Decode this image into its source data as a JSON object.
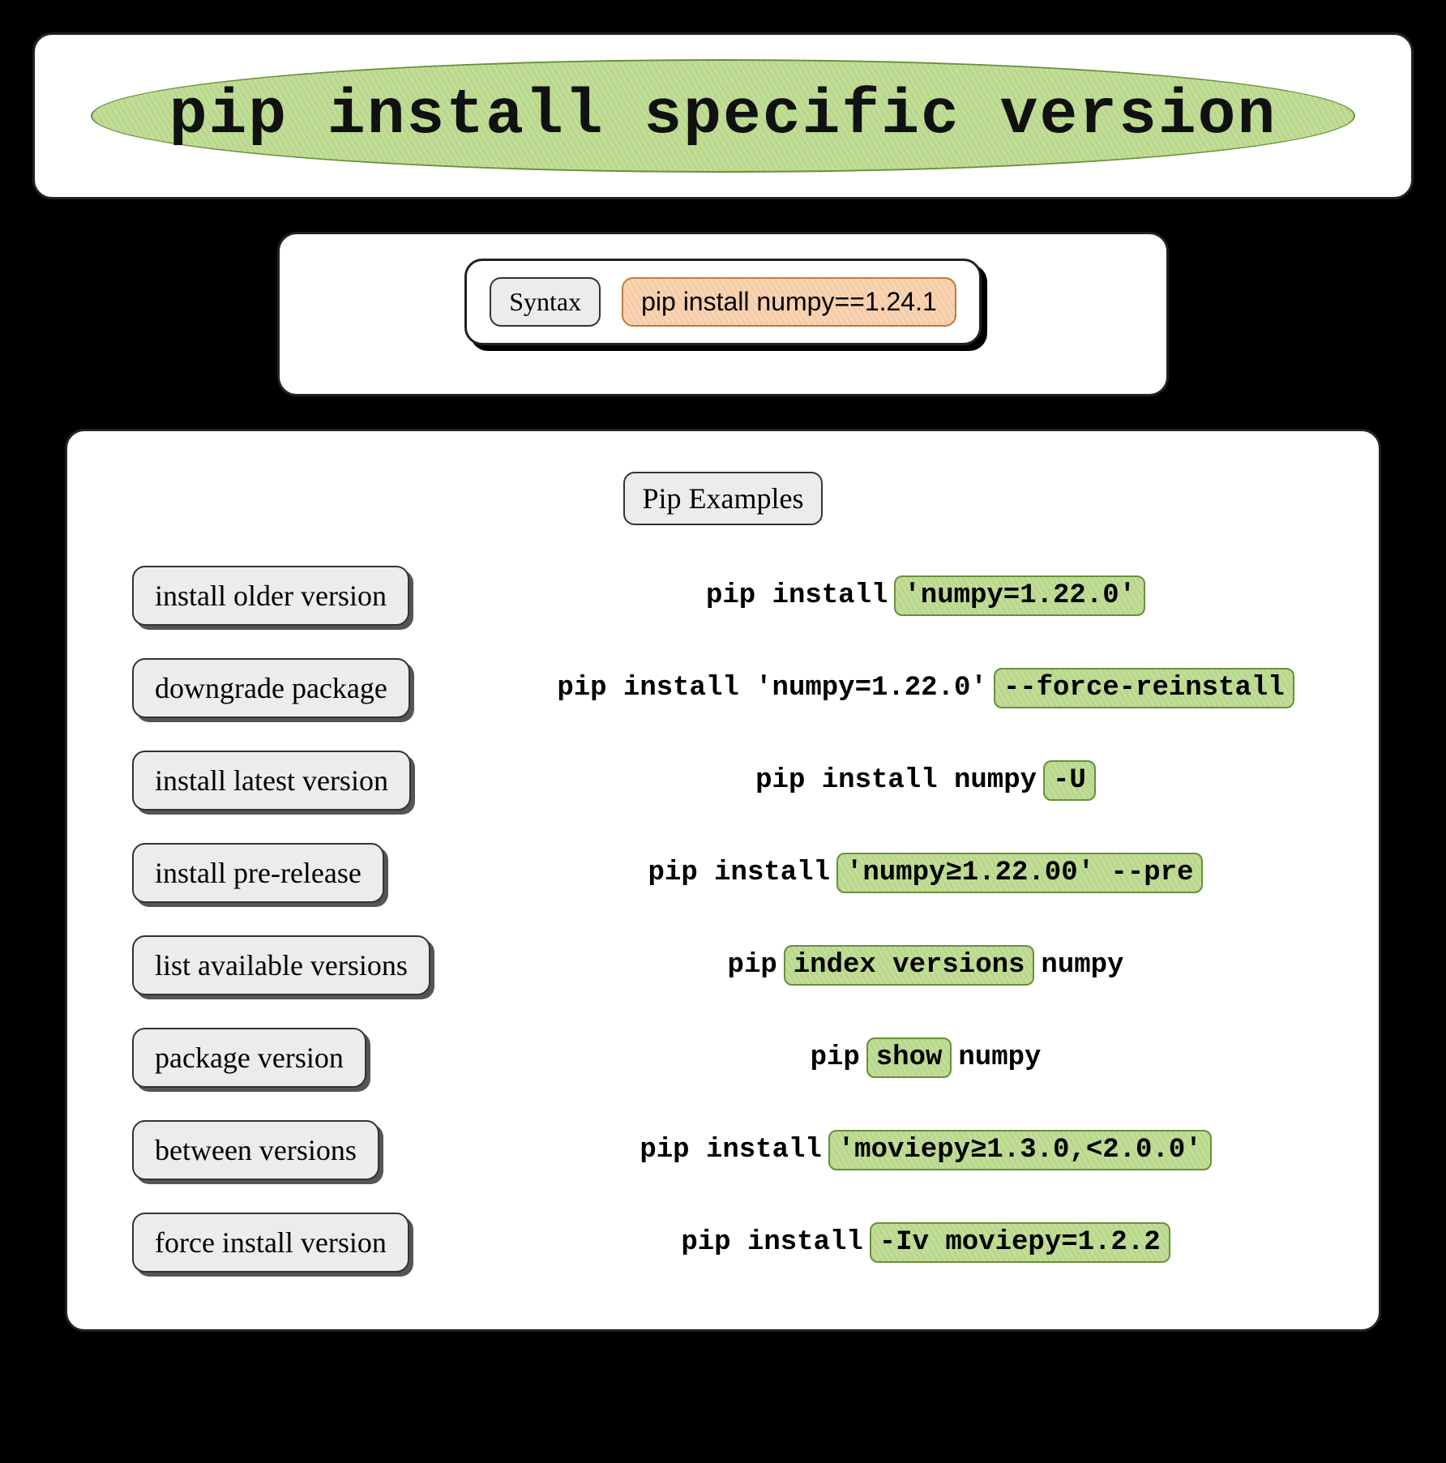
{
  "header": {
    "title": "pip install specific version"
  },
  "syntax": {
    "label": "Syntax",
    "command": "pip install numpy==1.24.1"
  },
  "section_title": "Pip Examples",
  "examples": [
    {
      "label": "install older version",
      "parts": [
        {
          "text": "pip install ",
          "hl": false
        },
        {
          "text": "'numpy=1.22.0'",
          "hl": true
        }
      ]
    },
    {
      "label": "downgrade package",
      "parts": [
        {
          "text": "pip install 'numpy=1.22.0'",
          "hl": false
        },
        {
          "text": "--force-reinstall",
          "hl": true
        }
      ]
    },
    {
      "label": "install latest version",
      "parts": [
        {
          "text": "pip install numpy ",
          "hl": false
        },
        {
          "text": "-U",
          "hl": true
        }
      ]
    },
    {
      "label": "install pre-release",
      "parts": [
        {
          "text": "pip install ",
          "hl": false
        },
        {
          "text": "'numpy≥1.22.00' --pre",
          "hl": true
        }
      ]
    },
    {
      "label": "list available versions",
      "parts": [
        {
          "text": "pip ",
          "hl": false
        },
        {
          "text": "index versions",
          "hl": true
        },
        {
          "text": " numpy",
          "hl": false
        }
      ]
    },
    {
      "label": "package version",
      "parts": [
        {
          "text": "pip ",
          "hl": false
        },
        {
          "text": "show",
          "hl": true
        },
        {
          "text": " numpy",
          "hl": false
        }
      ]
    },
    {
      "label": "between versions",
      "parts": [
        {
          "text": "pip install ",
          "hl": false
        },
        {
          "text": "'moviepy≥1.3.0,<2.0.0'",
          "hl": true
        }
      ]
    },
    {
      "label": "force install version",
      "parts": [
        {
          "text": "pip install ",
          "hl": false
        },
        {
          "text": "-Iv moviepy=1.2.2",
          "hl": true
        }
      ]
    }
  ]
}
